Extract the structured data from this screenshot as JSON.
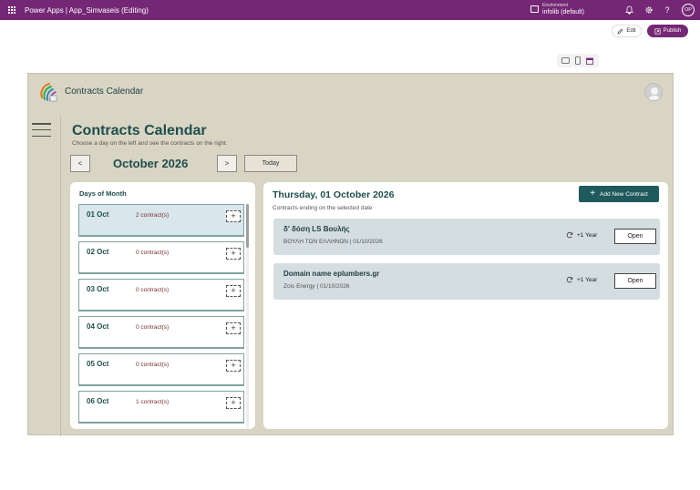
{
  "studio": {
    "title": "Power Apps  |  App_Simvaseis (Editing)",
    "environment_label": "Environment",
    "environment_name": "infolib (default)",
    "user_initials": "OP",
    "edit_label": "Edit",
    "publish_label": "Publish"
  },
  "app": {
    "name": "Contracts Calendar"
  },
  "page": {
    "title": "Contracts Calendar",
    "subtitle": "Choose a day on the left and see the contracts on the right.",
    "prev_label": "<",
    "next_label": ">",
    "month": "October 2026",
    "today_label": "Today"
  },
  "days_panel": {
    "title": "Days of Month",
    "add_symbol": "+",
    "days": [
      {
        "date": "01 Oct",
        "count": "2 contract(s)"
      },
      {
        "date": "02 Oct",
        "count": "0 contract(s)"
      },
      {
        "date": "03 Oct",
        "count": "0 contract(s)"
      },
      {
        "date": "04 Oct",
        "count": "0 contract(s)"
      },
      {
        "date": "05 Oct",
        "count": "0 contract(s)"
      },
      {
        "date": "06 Oct",
        "count": "1 contract(s)"
      }
    ]
  },
  "contracts_panel": {
    "selected_date": "Thursday, 01 October 2026",
    "subtitle": "Contracts ending on the selected date",
    "add_label": "Add New Contract",
    "contracts": [
      {
        "title": "δ' δόση LS Βουλής",
        "subtitle": "ΒΟΥΛΗ ΤΩΝ ΕΛΛΗΝΩΝ | 01/10/2026",
        "renew": "+1 Year",
        "open_label": "Open"
      },
      {
        "title": "Domain name eplumbers.gr",
        "subtitle": "Zois Energy | 01/10/2026",
        "renew": "+1 Year",
        "open_label": "Open"
      }
    ]
  },
  "colors": {
    "powerapps_purple": "#742774",
    "accent_teal": "#1f5a5c",
    "canvas_background": "#d9d5c4",
    "selected_day": "#d9e6ec",
    "card_background": "#d4dde0"
  }
}
